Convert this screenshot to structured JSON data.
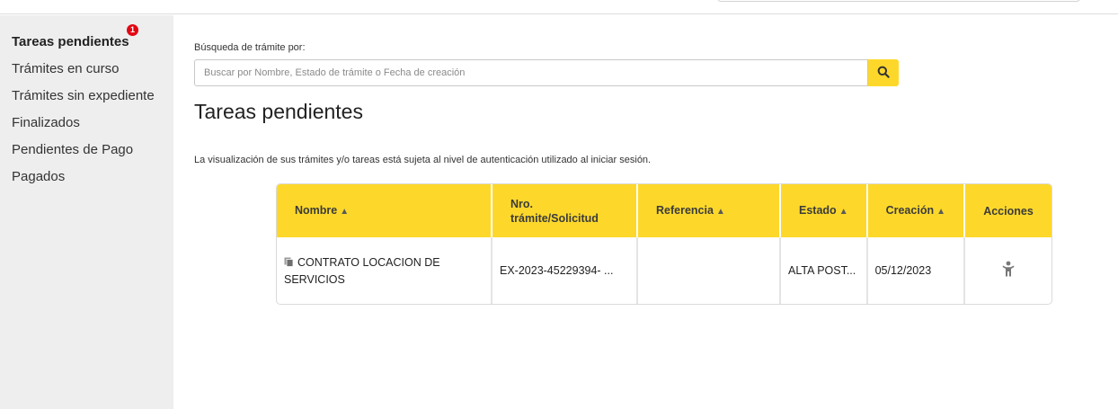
{
  "sidebar": {
    "items": [
      {
        "label": "Tareas pendientes",
        "badge": "1"
      },
      {
        "label": "Trámites en curso"
      },
      {
        "label": "Trámites sin expediente"
      },
      {
        "label": "Finalizados"
      },
      {
        "label": "Pendientes de Pago"
      },
      {
        "label": "Pagados"
      }
    ]
  },
  "search": {
    "label": "Búsqueda de trámite por:",
    "placeholder": "Buscar por Nombre, Estado de trámite o Fecha de creación",
    "value": ""
  },
  "main": {
    "title": "Tareas pendientes",
    "notice": "La visualización de sus trámites y/o tareas está sujeta al nivel de autenticación utilizado al iniciar sesión."
  },
  "table": {
    "headers": {
      "nombre": "Nombre",
      "nro_line1": "Nro.",
      "nro_line2": "trámite/Solicitud",
      "referencia": "Referencia",
      "estado": "Estado",
      "creacion": "Creación",
      "acciones": "Acciones"
    },
    "rows": [
      {
        "nombre": "CONTRATO LOCACION DE SERVICIOS",
        "nro": "EX-2023-45229394- ...",
        "referencia": "",
        "estado": "ALTA POST...",
        "creacion": "05/12/2023",
        "accion_icon": "person-action-icon"
      }
    ]
  },
  "colors": {
    "accent": "#fdd82a",
    "sidebar_bg": "#eeeeee",
    "badge": "#e30613"
  }
}
